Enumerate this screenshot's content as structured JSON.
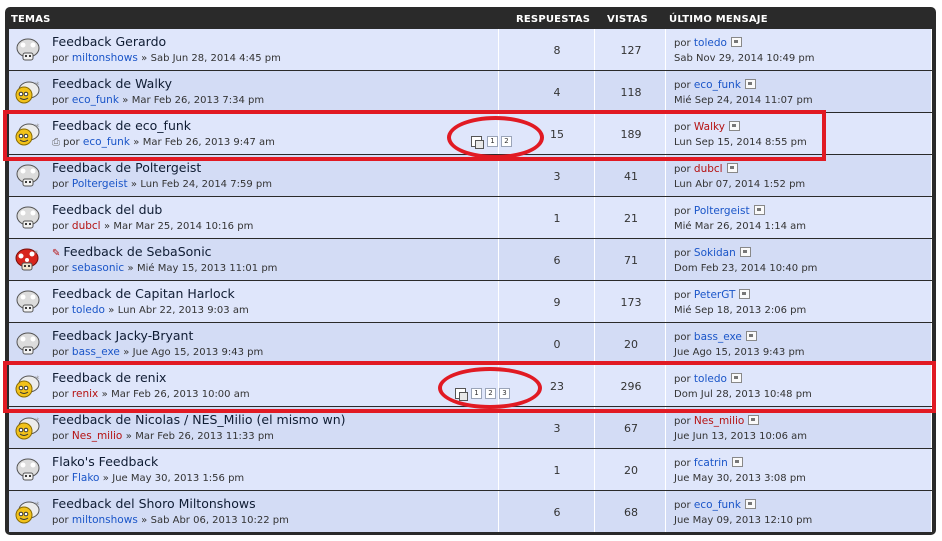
{
  "header": {
    "topics": "TEMAS",
    "replies": "RESPUESTAS",
    "views": "VISTAS",
    "last": "ÚLTIMO MENSAJE"
  },
  "rows": [
    {
      "title": "Feedback Gerardo",
      "by": "por",
      "author": "miltonshows",
      "author_color": "blue",
      "sep": "»",
      "date": "Sab Jun 28, 2014 4:45 pm",
      "replies": "8",
      "views": "127",
      "last_by": "por",
      "last_author": "toledo",
      "last_author_color": "blue",
      "last_date": "Sab Nov 29, 2014 10:49 pm",
      "icon": "topic-read-icon",
      "alt": false
    },
    {
      "title": "Feedback de Walky",
      "by": "por",
      "author": "eco_funk",
      "author_color": "blue",
      "sep": "»",
      "date": "Mar Feb 26, 2013 7:34 pm",
      "replies": "4",
      "views": "118",
      "last_by": "por",
      "last_author": "eco_funk",
      "last_author_color": "blue",
      "last_date": "Mié Sep 24, 2014 11:07 pm",
      "icon": "topic-posted-icon",
      "alt": true
    },
    {
      "title": "Feedback de eco_funk",
      "by": "por",
      "author": "eco_funk",
      "author_color": "blue",
      "sep": "»",
      "date": "Mar Feb 26, 2013 9:47 am",
      "replies": "15",
      "views": "189",
      "last_by": "por",
      "last_author": "Walky",
      "last_author_color": "red",
      "last_date": "Lun Sep 15, 2014 8:55 pm",
      "icon": "topic-posted-icon",
      "attach": true,
      "pages": [
        "1",
        "2"
      ],
      "alt": false
    },
    {
      "title": "Feedback de Poltergeist",
      "by": "por",
      "author": "Poltergeist",
      "author_color": "blue",
      "sep": "»",
      "date": "Lun Feb 24, 2014 7:59 pm",
      "replies": "3",
      "views": "41",
      "last_by": "por",
      "last_author": "dubcl",
      "last_author_color": "red",
      "last_date": "Lun Abr 07, 2014 1:52 pm",
      "icon": "topic-read-icon",
      "alt": true
    },
    {
      "title": "Feedback del dub",
      "by": "por",
      "author": "dubcl",
      "author_color": "red",
      "sep": "»",
      "date": "Mar Mar 25, 2014 10:16 pm",
      "replies": "1",
      "views": "21",
      "last_by": "por",
      "last_author": "Poltergeist",
      "last_author_color": "blue",
      "last_date": "Mié Mar 26, 2014 1:14 am",
      "icon": "topic-read-icon",
      "alt": false
    },
    {
      "title": "Feedback de SebaSonic",
      "by": "por",
      "author": "sebasonic",
      "author_color": "blue",
      "sep": "»",
      "date": "Mié May 15, 2013 11:01 pm",
      "replies": "6",
      "views": "71",
      "last_by": "por",
      "last_author": "Sokidan",
      "last_author_color": "blue",
      "last_date": "Dom Feb 23, 2014 10:40 pm",
      "icon": "topic-hot-icon",
      "edit": true,
      "alt": true
    },
    {
      "title": "Feedback de Capitan Harlock",
      "by": "por",
      "author": "toledo",
      "author_color": "blue",
      "sep": "»",
      "date": "Lun Abr 22, 2013 9:03 am",
      "replies": "9",
      "views": "173",
      "last_by": "por",
      "last_author": "PeterGT",
      "last_author_color": "blue",
      "last_date": "Mié Sep 18, 2013 2:06 pm",
      "icon": "topic-read-icon",
      "alt": false
    },
    {
      "title": "Feedback Jacky-Bryant",
      "by": "por",
      "author": "bass_exe",
      "author_color": "blue",
      "sep": "»",
      "date": "Jue Ago 15, 2013 9:43 pm",
      "replies": "0",
      "views": "20",
      "last_by": "por",
      "last_author": "bass_exe",
      "last_author_color": "blue",
      "last_date": "Jue Ago 15, 2013 9:43 pm",
      "icon": "topic-read-icon",
      "alt": true
    },
    {
      "title": "Feedback de renix",
      "by": "por",
      "author": "renix",
      "author_color": "red",
      "sep": "»",
      "date": "Mar Feb 26, 2013 10:00 am",
      "replies": "23",
      "views": "296",
      "last_by": "por",
      "last_author": "toledo",
      "last_author_color": "blue",
      "last_date": "Dom Jul 28, 2013 10:48 pm",
      "icon": "topic-posted-icon",
      "pages": [
        "1",
        "2",
        "3"
      ],
      "alt": false
    },
    {
      "title": "Feedback de Nicolas / NES_Milio (el mismo wn)",
      "by": "por",
      "author": "Nes_milio",
      "author_color": "red",
      "sep": "»",
      "date": "Mar Feb 26, 2013 11:33 pm",
      "replies": "3",
      "views": "67",
      "last_by": "por",
      "last_author": "Nes_milio",
      "last_author_color": "red",
      "last_date": "Jue Jun 13, 2013 10:06 am",
      "icon": "topic-posted-icon",
      "alt": true
    },
    {
      "title": "Flako's Feedback",
      "by": "por",
      "author": "Flako",
      "author_color": "blue",
      "sep": "»",
      "date": "Jue May 30, 2013 1:56 pm",
      "replies": "1",
      "views": "20",
      "last_by": "por",
      "last_author": "fcatrin",
      "last_author_color": "blue",
      "last_date": "Jue May 30, 2013 3:08 pm",
      "icon": "topic-read-icon",
      "alt": false
    },
    {
      "title": "Feedback del Shoro Miltonshows",
      "by": "por",
      "author": "miltonshows",
      "author_color": "blue",
      "sep": "»",
      "date": "Sab Abr 06, 2013 10:22 pm",
      "replies": "6",
      "views": "68",
      "last_by": "por",
      "last_author": "eco_funk",
      "last_author_color": "blue",
      "last_date": "Jue May 09, 2013 12:10 pm",
      "icon": "topic-posted-icon",
      "alt": true
    }
  ],
  "colors": {
    "accent_red": "#e11a23",
    "link_blue": "#1a55c8",
    "link_red": "#b51212",
    "row_a": "#dfe6fb",
    "row_b": "#d3dcf5"
  }
}
